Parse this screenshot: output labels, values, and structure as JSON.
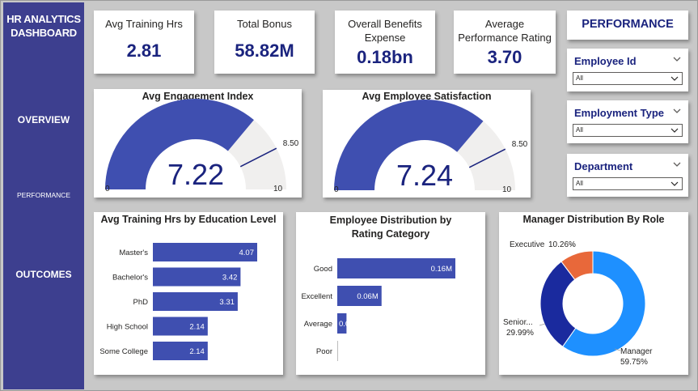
{
  "sidebar": {
    "title": "HR ANALYTICS DASHBOARD",
    "items": [
      {
        "label": "OVERVIEW"
      },
      {
        "label": "PERFORMANCE"
      },
      {
        "label": "OUTCOMES"
      }
    ]
  },
  "kpis": [
    {
      "label": "Avg Training Hrs",
      "value": "2.81"
    },
    {
      "label": "Total Bonus",
      "value": "58.82M"
    },
    {
      "label": "Overall Benefits Expense",
      "value": "0.18bn"
    },
    {
      "label": "Average Performance Rating",
      "value": "3.70"
    }
  ],
  "page_title": "PERFORMANCE",
  "slicers": [
    {
      "title": "Employee Id",
      "value": "All"
    },
    {
      "title": "Employment Type",
      "value": "All"
    },
    {
      "title": "Department",
      "value": "All"
    }
  ],
  "colors": {
    "sidebar": "#3d3f8f",
    "bar": "#3f4fb0",
    "gauge_fill": "#3f4fb0",
    "gauge_track": "#f0efee",
    "target_line": "#1a237e",
    "value_text": "#1a237e",
    "donut_manager": "#1e90ff",
    "donut_senior": "#1a2a9e",
    "donut_executive": "#e8683a"
  },
  "chart_data": [
    {
      "type": "gauge",
      "title": "Avg Engagement Index",
      "value": 7.22,
      "value_label": "7.22",
      "min": 0,
      "max": 10,
      "target": 8.5,
      "min_label": "0",
      "max_label": "10",
      "target_label": "8.50"
    },
    {
      "type": "gauge",
      "title": "Avg Employee Satisfaction",
      "value": 7.24,
      "value_label": "7.24",
      "min": 0,
      "max": 10,
      "target": 8.5,
      "min_label": "0",
      "max_label": "10",
      "target_label": "8.50"
    },
    {
      "type": "bar",
      "orientation": "horizontal",
      "title": "Avg Training Hrs by Education Level",
      "categories": [
        "Master's",
        "Bachelor's",
        "PhD",
        "High School",
        "Some College"
      ],
      "values": [
        4.07,
        3.42,
        3.31,
        2.14,
        2.14
      ],
      "labels": [
        "4.07",
        "3.42",
        "3.31",
        "2.14",
        "2.14"
      ],
      "xlim": [
        0,
        4.07
      ]
    },
    {
      "type": "bar",
      "orientation": "horizontal",
      "title": "Employee Distribution by Rating Category",
      "categories": [
        "Good",
        "Excellent",
        "Average",
        "Poor"
      ],
      "values": [
        0.16,
        0.06,
        0.0125,
        0
      ],
      "labels": [
        "0.16M",
        "0.06M",
        "0.0",
        ""
      ],
      "xlim": [
        0,
        0.16
      ]
    },
    {
      "type": "pie",
      "donut": true,
      "title": "Manager Distribution By Role",
      "slices": [
        {
          "name": "Manager",
          "value": 59.75,
          "label": "59.75%"
        },
        {
          "name": "Senior...",
          "value": 29.99,
          "label": "29.99%"
        },
        {
          "name": "Executive",
          "value": 10.26,
          "label": "10.26%"
        }
      ]
    }
  ]
}
